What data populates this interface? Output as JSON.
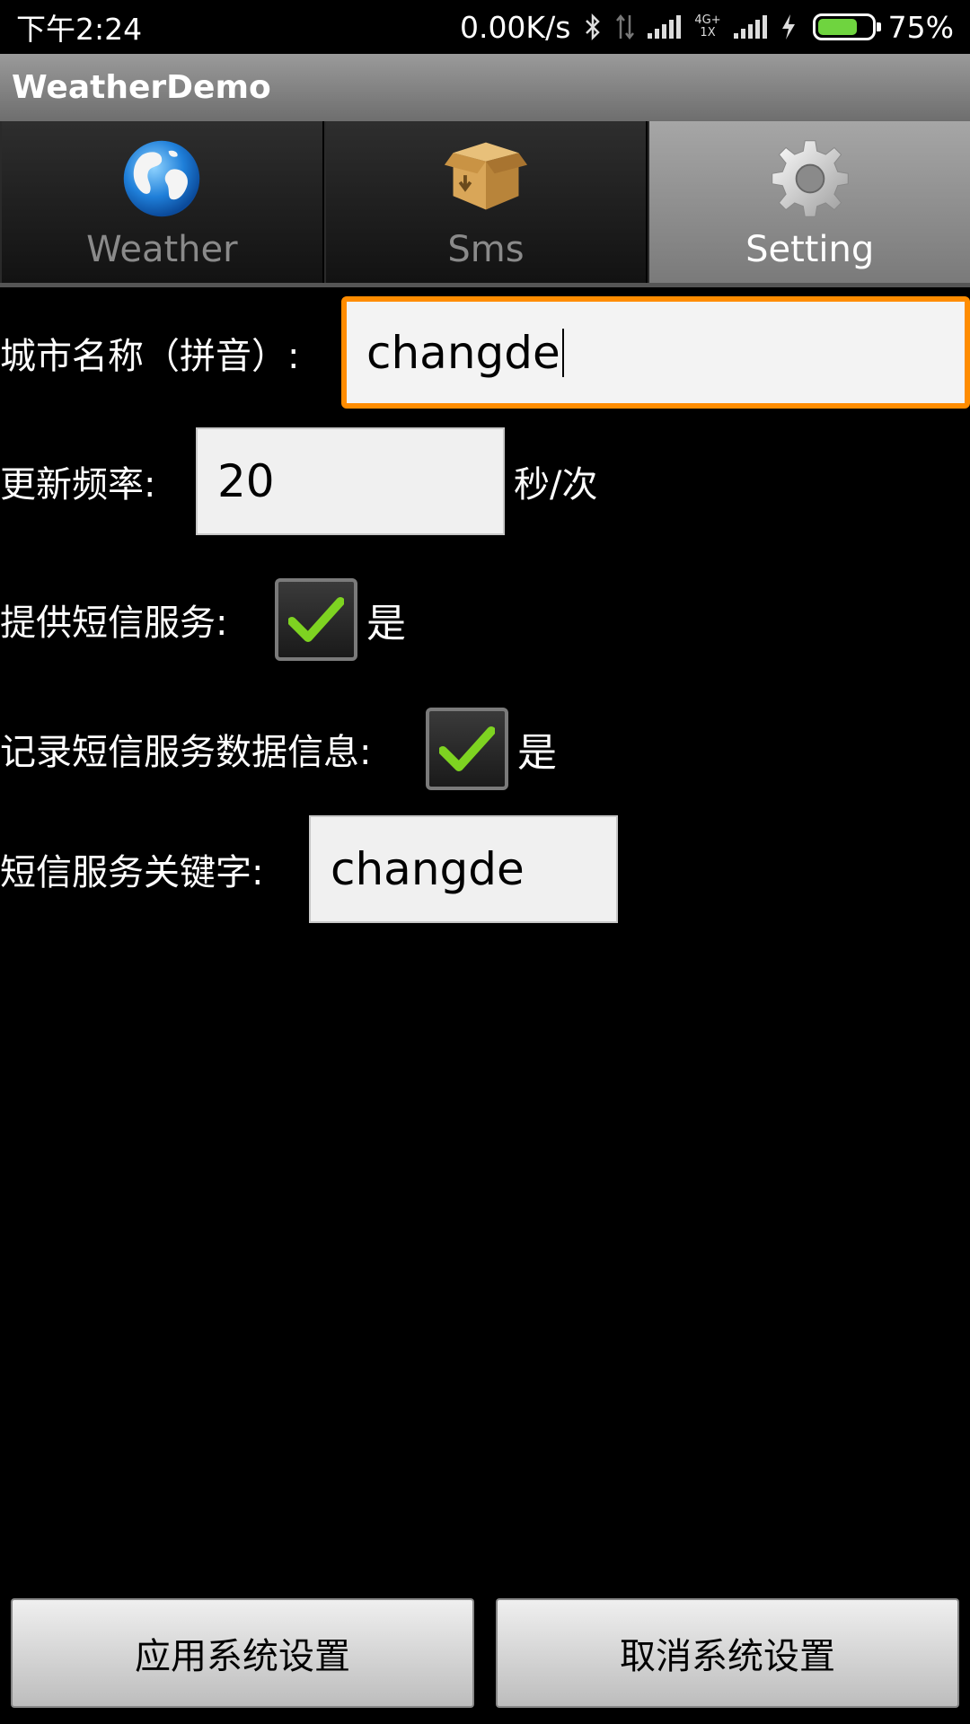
{
  "status_bar": {
    "time": "下午2:24",
    "net_speed": "0.00K/s",
    "network_type_top": "4G+",
    "network_type_bottom": "1X",
    "battery_percent": "75%",
    "battery_level": 0.75
  },
  "app": {
    "title": "WeatherDemo"
  },
  "tabs": [
    {
      "label": "Weather",
      "icon": "globe-icon",
      "active": false
    },
    {
      "label": "Sms",
      "icon": "package-box-icon",
      "active": false
    },
    {
      "label": "Setting",
      "icon": "gear-icon",
      "active": true
    }
  ],
  "form": {
    "city": {
      "label": "城市名称（拼音）:",
      "value": "changde"
    },
    "update_rate": {
      "label": "更新频率:",
      "value": "20",
      "unit": "秒/次"
    },
    "sms_service": {
      "label": "提供短信服务:",
      "checked": true,
      "option_label": "是"
    },
    "log_sms": {
      "label": "记录短信服务数据信息:",
      "checked": true,
      "option_label": "是"
    },
    "sms_keyword": {
      "label": "短信服务关键字:",
      "value": "changde"
    }
  },
  "buttons": {
    "apply": "应用系统设置",
    "cancel": "取消系统设置"
  },
  "colors": {
    "focus_border": "#ff8c00",
    "check_green": "#7ed321",
    "battery_green": "#6fd43f"
  }
}
